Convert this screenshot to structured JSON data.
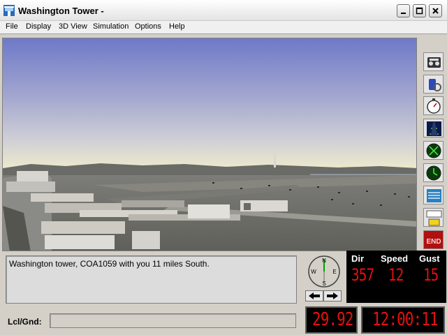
{
  "window": {
    "title": "Washington Tower -"
  },
  "menu": [
    "File",
    "Display",
    "3D View",
    "Simulation",
    "Options",
    "Help"
  ],
  "toolbar": [
    {
      "icon": "radio-icon"
    },
    {
      "icon": "mask-icon"
    },
    {
      "icon": "stopwatch-icon"
    },
    {
      "icon": "runway-icon"
    },
    {
      "icon": "radar-icon"
    },
    {
      "icon": "radar-clock-icon"
    },
    {
      "icon": "list-icon"
    },
    {
      "icon": "strip-icon"
    },
    {
      "icon": "end-icon",
      "label": "END"
    }
  ],
  "message": {
    "text": "Washington tower, COA1059 with you 11 miles South."
  },
  "lcl": {
    "label": "Lcl/Gnd:",
    "value": ""
  },
  "compass": {
    "n": "N",
    "e": "E",
    "s": "S",
    "w": "W"
  },
  "wind": {
    "dir_label": "Dir",
    "speed_label": "Speed",
    "gust_label": "Gust",
    "dir": "357",
    "speed": "12",
    "gust": "15"
  },
  "baro": "29.92",
  "clock": "12:00:11",
  "colors": {
    "led": "#e8100c",
    "panel": "#d4d0c8"
  }
}
